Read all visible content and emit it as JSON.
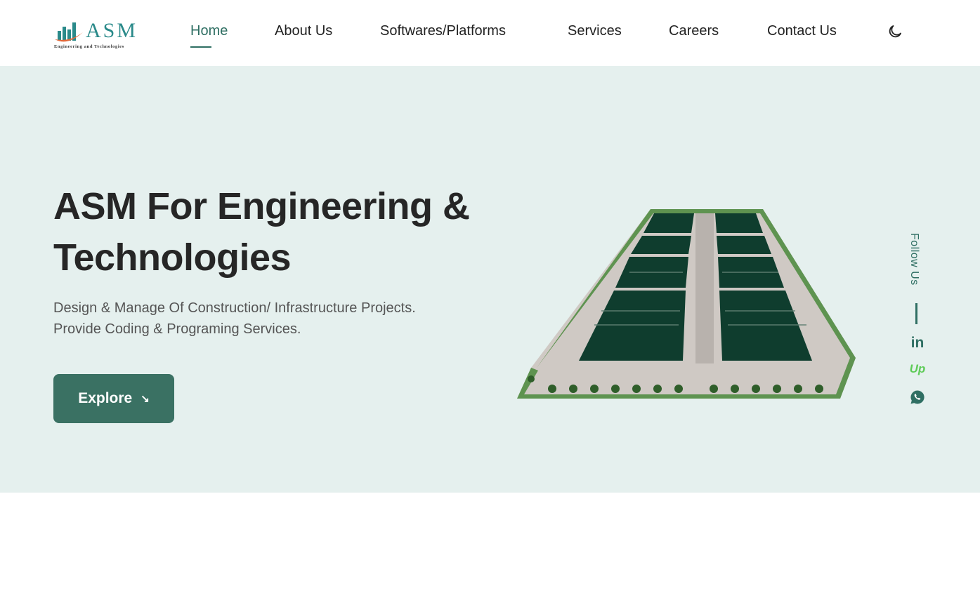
{
  "logo": {
    "text": "ASM",
    "subtitle": "Engineering and Technologies"
  },
  "nav": {
    "items": [
      {
        "label": "Home",
        "active": true
      },
      {
        "label": "About Us"
      },
      {
        "label": "Softwares/Platforms"
      },
      {
        "label": "Services"
      },
      {
        "label": "Careers"
      },
      {
        "label": "Contact Us"
      }
    ],
    "theme_icon": "moon-icon"
  },
  "hero": {
    "title_line1": "ASM For Engineering &",
    "title_line2": "Technologies",
    "desc_line1": "Design & Manage Of Construction/ Infrastructure Projects.",
    "desc_line2": "Provide Coding & Programing Services.",
    "button_label": "Explore",
    "button_icon": "arrow-down-right-icon"
  },
  "follow": {
    "label": "Follow Us",
    "linkedin": "in",
    "upwork": "Up",
    "icons": [
      "linkedin-icon",
      "upwork-icon",
      "whatsapp-icon"
    ]
  },
  "colors": {
    "accent": "#2f6f63",
    "button": "#3a7163",
    "hero_bg": "#e5f0ee",
    "logo": "#2a8a8a",
    "upwork": "#5ecb58"
  }
}
